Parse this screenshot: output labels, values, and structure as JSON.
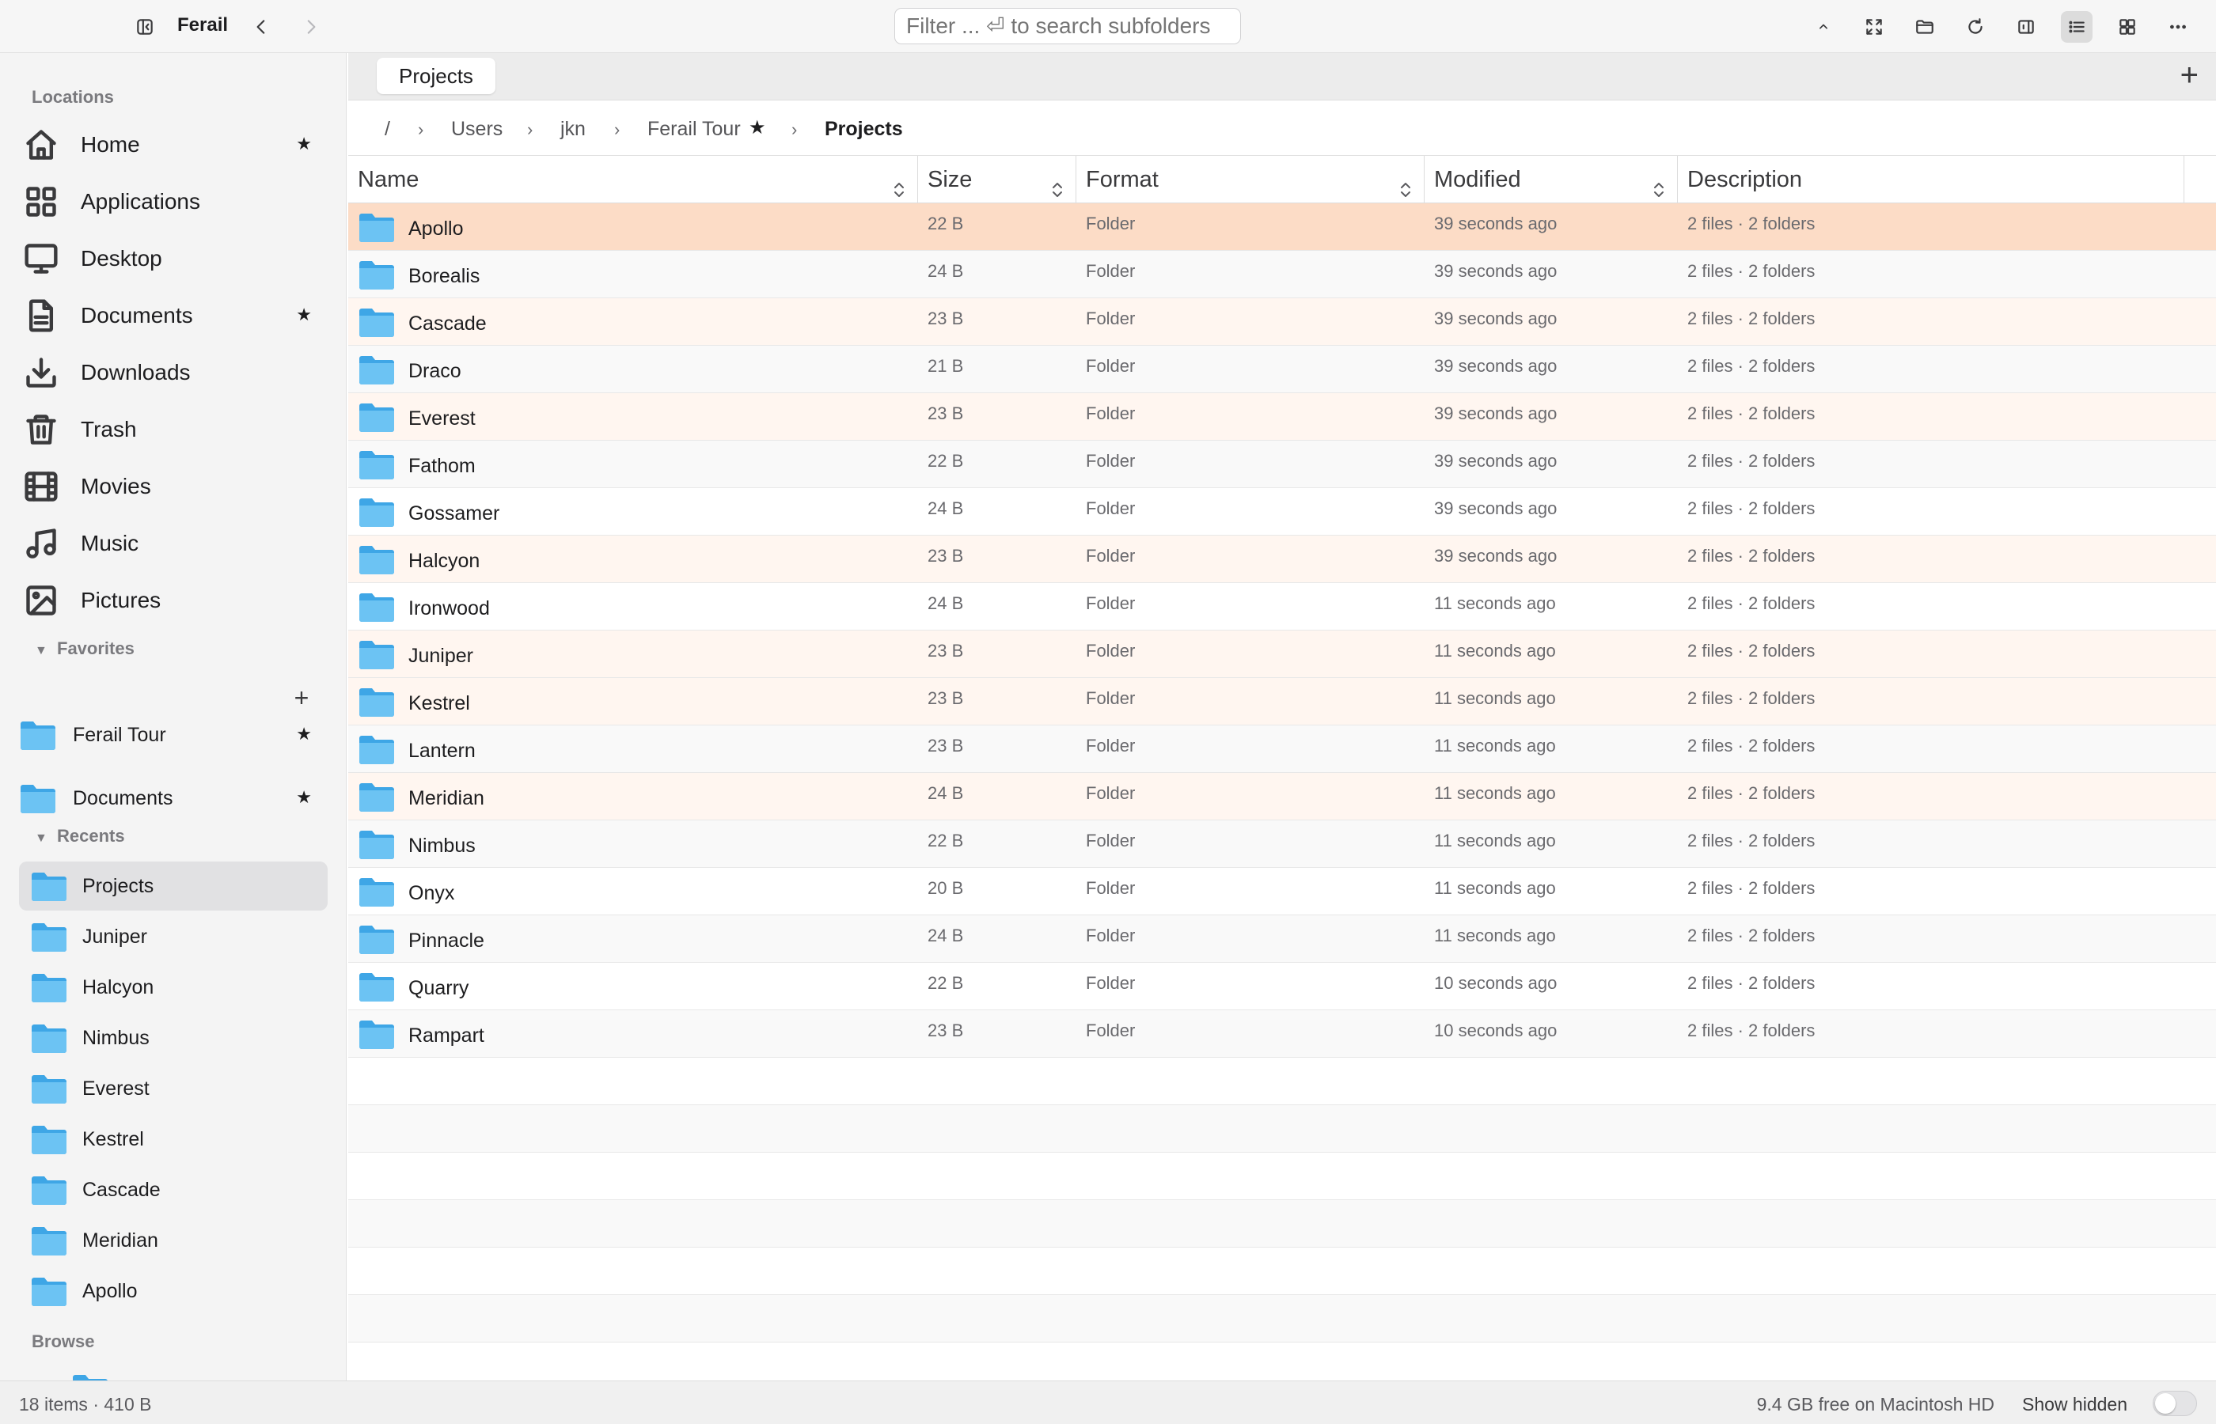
{
  "app": {
    "title": "Ferail"
  },
  "filter": {
    "placeholder": "Filter ... ⏎ to search subfolders"
  },
  "sidebar": {
    "locations_title": "Locations",
    "locations": [
      {
        "label": "Home",
        "icon": "home-icon",
        "starred": true
      },
      {
        "label": "Applications",
        "icon": "applications-icon",
        "starred": false
      },
      {
        "label": "Desktop",
        "icon": "desktop-icon",
        "starred": false
      },
      {
        "label": "Documents",
        "icon": "document-icon",
        "starred": true
      },
      {
        "label": "Downloads",
        "icon": "download-icon",
        "starred": false
      },
      {
        "label": "Trash",
        "icon": "trash-icon",
        "starred": false
      },
      {
        "label": "Movies",
        "icon": "film-icon",
        "starred": false
      },
      {
        "label": "Music",
        "icon": "music-icon",
        "starred": false
      },
      {
        "label": "Pictures",
        "icon": "picture-icon",
        "starred": false
      }
    ],
    "favorites_title": "Favorites",
    "favorites": [
      {
        "label": "Ferail Tour",
        "starred": true
      },
      {
        "label": "Documents",
        "starred": true
      }
    ],
    "recents_title": "Recents",
    "recents": [
      {
        "label": "Projects",
        "selected": true
      },
      {
        "label": "Juniper"
      },
      {
        "label": "Halcyon"
      },
      {
        "label": "Nimbus"
      },
      {
        "label": "Everest"
      },
      {
        "label": "Kestrel"
      },
      {
        "label": "Cascade"
      },
      {
        "label": "Meridian"
      },
      {
        "label": "Apollo"
      }
    ],
    "browse_title": "Browse"
  },
  "tabs": [
    {
      "label": "Projects",
      "active": true
    }
  ],
  "breadcrumb": {
    "root": "/",
    "items": [
      "Users",
      "jkn",
      "Ferail Tour"
    ],
    "starred_item": "Ferail Tour",
    "current": "Projects"
  },
  "table": {
    "columns": [
      "Name",
      "Size",
      "Format",
      "Modified",
      "Description"
    ],
    "rows": [
      {
        "name": "Apollo",
        "size": "22 B",
        "format": "Folder",
        "modified": "39 seconds ago",
        "description": "2 files · 2 folders"
      },
      {
        "name": "Borealis",
        "size": "24 B",
        "format": "Folder",
        "modified": "39 seconds ago",
        "description": "2 files · 2 folders"
      },
      {
        "name": "Cascade",
        "size": "23 B",
        "format": "Folder",
        "modified": "39 seconds ago",
        "description": "2 files · 2 folders"
      },
      {
        "name": "Draco",
        "size": "21 B",
        "format": "Folder",
        "modified": "39 seconds ago",
        "description": "2 files · 2 folders"
      },
      {
        "name": "Everest",
        "size": "23 B",
        "format": "Folder",
        "modified": "39 seconds ago",
        "description": "2 files · 2 folders"
      },
      {
        "name": "Fathom",
        "size": "22 B",
        "format": "Folder",
        "modified": "39 seconds ago",
        "description": "2 files · 2 folders"
      },
      {
        "name": "Gossamer",
        "size": "24 B",
        "format": "Folder",
        "modified": "39 seconds ago",
        "description": "2 files · 2 folders"
      },
      {
        "name": "Halcyon",
        "size": "23 B",
        "format": "Folder",
        "modified": "39 seconds ago",
        "description": "2 files · 2 folders"
      },
      {
        "name": "Ironwood",
        "size": "24 B",
        "format": "Folder",
        "modified": "11 seconds ago",
        "description": "2 files · 2 folders"
      },
      {
        "name": "Juniper",
        "size": "23 B",
        "format": "Folder",
        "modified": "11 seconds ago",
        "description": "2 files · 2 folders"
      },
      {
        "name": "Kestrel",
        "size": "23 B",
        "format": "Folder",
        "modified": "11 seconds ago",
        "description": "2 files · 2 folders"
      },
      {
        "name": "Lantern",
        "size": "23 B",
        "format": "Folder",
        "modified": "11 seconds ago",
        "description": "2 files · 2 folders"
      },
      {
        "name": "Meridian",
        "size": "24 B",
        "format": "Folder",
        "modified": "11 seconds ago",
        "description": "2 files · 2 folders"
      },
      {
        "name": "Nimbus",
        "size": "22 B",
        "format": "Folder",
        "modified": "11 seconds ago",
        "description": "2 files · 2 folders"
      },
      {
        "name": "Onyx",
        "size": "20 B",
        "format": "Folder",
        "modified": "11 seconds ago",
        "description": "2 files · 2 folders"
      },
      {
        "name": "Pinnacle",
        "size": "24 B",
        "format": "Folder",
        "modified": "11 seconds ago",
        "description": "2 files · 2 folders"
      },
      {
        "name": "Quarry",
        "size": "22 B",
        "format": "Folder",
        "modified": "10 seconds ago",
        "description": "2 files · 2 folders"
      },
      {
        "name": "Rampart",
        "size": "23 B",
        "format": "Folder",
        "modified": "10 seconds ago",
        "description": "2 files · 2 folders"
      }
    ],
    "selected_row": "Apollo",
    "tinted_rows": [
      "Cascade",
      "Everest",
      "Halcyon",
      "Juniper",
      "Kestrel",
      "Meridian"
    ]
  },
  "status": {
    "count": "18 items · 410 B",
    "free": "9.4 GB free on Macintosh HD",
    "show_hidden_label": "Show hidden",
    "show_hidden": false
  },
  "colors": {
    "selection": "#fcdcc6",
    "tint": "#fff6f0",
    "folder": "#4fb3ec"
  },
  "toolbar_icons": [
    "sidebar-toggle-icon",
    "back-icon",
    "forward-icon",
    "up-icon",
    "fullscreen-icon",
    "folder-icon",
    "refresh-icon",
    "panel-icon",
    "list-view-icon",
    "grid-view-icon",
    "more-icon"
  ]
}
